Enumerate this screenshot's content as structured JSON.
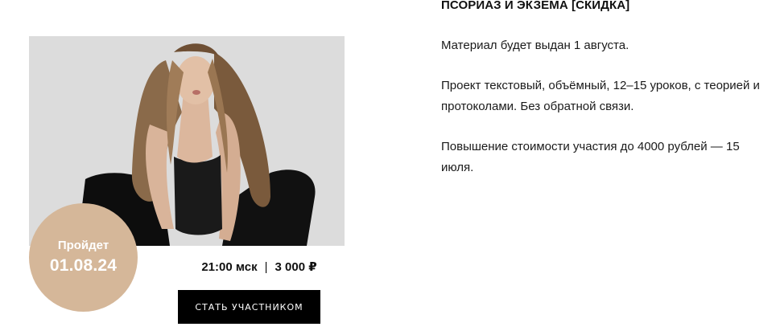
{
  "card": {
    "photo_alt": "model-photo",
    "badge_label": "Пройдет",
    "badge_date": "01.08.24",
    "time": "21:00 мск",
    "separator": "|",
    "price": "3 000 ₽",
    "cta_label": "СТАТЬ УЧАСТНИКОМ"
  },
  "details": {
    "title": "ПСОРИАЗ И ЭКЗЕМА [СКИДКА]",
    "paragraphs": [
      "Материал будет выдан 1 августа.",
      "Проект текстовый, объёмный, 12–15 уроков, с теорией и протоколами. Без обратной связи.",
      "Повышение стоимости участия до 4000 рублей — 15 июля."
    ]
  },
  "colors": {
    "badge": "#d5b799",
    "button": "#000000",
    "text": "#111111"
  }
}
